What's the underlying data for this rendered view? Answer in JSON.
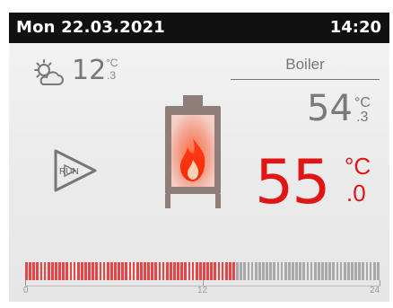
{
  "header": {
    "datetime": "Mon  22.03.2021",
    "time": "14:20"
  },
  "outside": {
    "temp_int": "12",
    "temp_unit": "°C",
    "temp_frac": ".3",
    "icon": "partly-cloudy-sun-icon"
  },
  "boiler": {
    "label": "Boiler",
    "set_int": "54",
    "set_unit": "°C",
    "set_frac": ".3",
    "current_int": "55",
    "current_unit": "°C",
    "current_frac": ".0",
    "stove_icon": "stove-fire-icon"
  },
  "status": {
    "mode": "RUN",
    "icon": "run-triangle-icon"
  },
  "timeline": {
    "ticks": [
      "0",
      "12",
      "24"
    ],
    "total_hours": 24,
    "active_until_hour": 14.33,
    "colors": {
      "active": "#e64646",
      "inactive": "#a8a8a8"
    }
  }
}
